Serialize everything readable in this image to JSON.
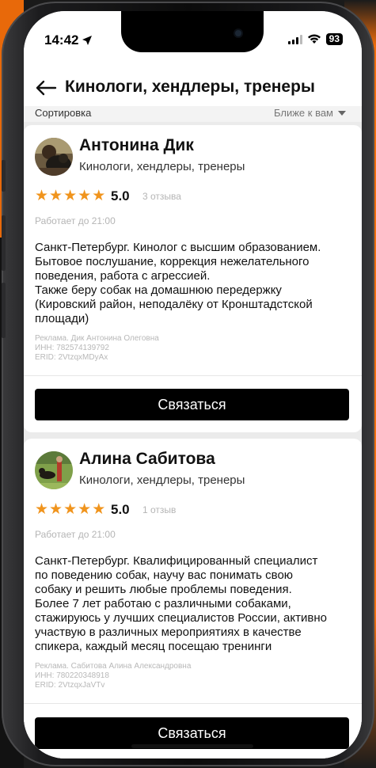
{
  "status_bar": {
    "time": "14:42",
    "battery": "93"
  },
  "header": {
    "title": "Кинологи, хендлеры, тренеры"
  },
  "sort": {
    "label": "Сортировка",
    "value": "Ближе к вам"
  },
  "listings": [
    {
      "name": "Антонина Дик",
      "category": "Кинологи, хендлеры, тренеры",
      "rating": "5.0",
      "stars": 5,
      "reviews": "3 отзыва",
      "hours": "Работает до 21:00",
      "description": "Санкт-Петербург. Кинолог с высшим образованием.\nБытовое послушание, коррекция нежелательного\nповедения, работа с агрессией.\nТакже беру собак на домашнюю передержку\n(Кировский район, неподалёку от Кронштадстской\nплощади)",
      "ad_line1": "Реклама. Дик Антонина Олеговна",
      "ad_line2": "ИНН: 782574139792",
      "ad_line3": "ERID: 2VtzqxMDyAx",
      "button": "Связаться"
    },
    {
      "name": "Алина Сабитова",
      "category": "Кинологи, хендлеры, тренеры",
      "rating": "5.0",
      "stars": 5,
      "reviews": "1 отзыв",
      "hours": "Работает до 21:00",
      "description": "Санкт-Петербург. Квалифицированный специалист\nпо поведению собак, научу вас понимать свою\nсобаку и решить любые проблемы поведения.\nБолее 7 лет работаю с различными собаками,\nстажируюсь у лучших специалистов России, активно\nучаствую в различных мероприятиях в качестве\nспикера, каждый месяц посещаю тренинги",
      "ad_line1": "Реклама. Сабитова Алина Александровна",
      "ad_line2": "ИНН: 780220348918",
      "ad_line3": "ERID: 2VtzqxJaVTv",
      "button": "Связаться"
    }
  ],
  "colors": {
    "star": "#f0941d",
    "button_bg": "#000000",
    "accent_bg": "#ef6d0c"
  }
}
